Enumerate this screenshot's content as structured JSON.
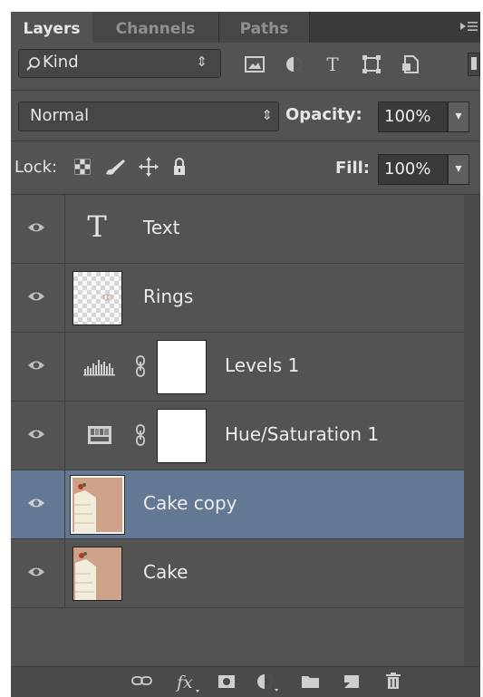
{
  "tabs": [
    {
      "label": "Layers",
      "active": true
    },
    {
      "label": "Channels",
      "active": false
    },
    {
      "label": "Paths",
      "active": false
    }
  ],
  "filter": {
    "kind_label": "Kind",
    "icons": [
      "image-filter-icon",
      "adjustment-filter-icon",
      "type-filter-icon",
      "shape-filter-icon",
      "smart-object-filter-icon"
    ]
  },
  "blend": {
    "mode": "Normal",
    "opacity_label": "Opacity:",
    "opacity_value": "100%"
  },
  "lock": {
    "label": "Lock:",
    "icons": [
      "lock-transparent-icon",
      "lock-image-icon",
      "lock-position-icon",
      "lock-all-icon"
    ],
    "fill_label": "Fill:",
    "fill_value": "100%"
  },
  "layers": [
    {
      "name": "Text",
      "type": "text",
      "visible": true,
      "selected": false
    },
    {
      "name": "Rings",
      "type": "pixel",
      "visible": true,
      "selected": false
    },
    {
      "name": "Levels 1",
      "type": "adjustment",
      "adjustment_icon": "levels-icon",
      "visible": true,
      "selected": false
    },
    {
      "name": "Hue/Saturation 1",
      "type": "adjustment",
      "adjustment_icon": "hue-saturation-icon",
      "visible": true,
      "selected": false
    },
    {
      "name": "Cake copy",
      "type": "image",
      "visible": true,
      "selected": true
    },
    {
      "name": "Cake",
      "type": "image",
      "visible": true,
      "selected": false
    }
  ],
  "bottom_icons": [
    "link-layers-icon",
    "fx-icon",
    "add-mask-icon",
    "new-fill-adjustment-icon",
    "new-group-icon",
    "new-layer-icon",
    "delete-layer-icon"
  ],
  "colors": {
    "panel_bg": "#535353",
    "selected_row": "#637893",
    "tab_bar": "#3b3b3b"
  }
}
